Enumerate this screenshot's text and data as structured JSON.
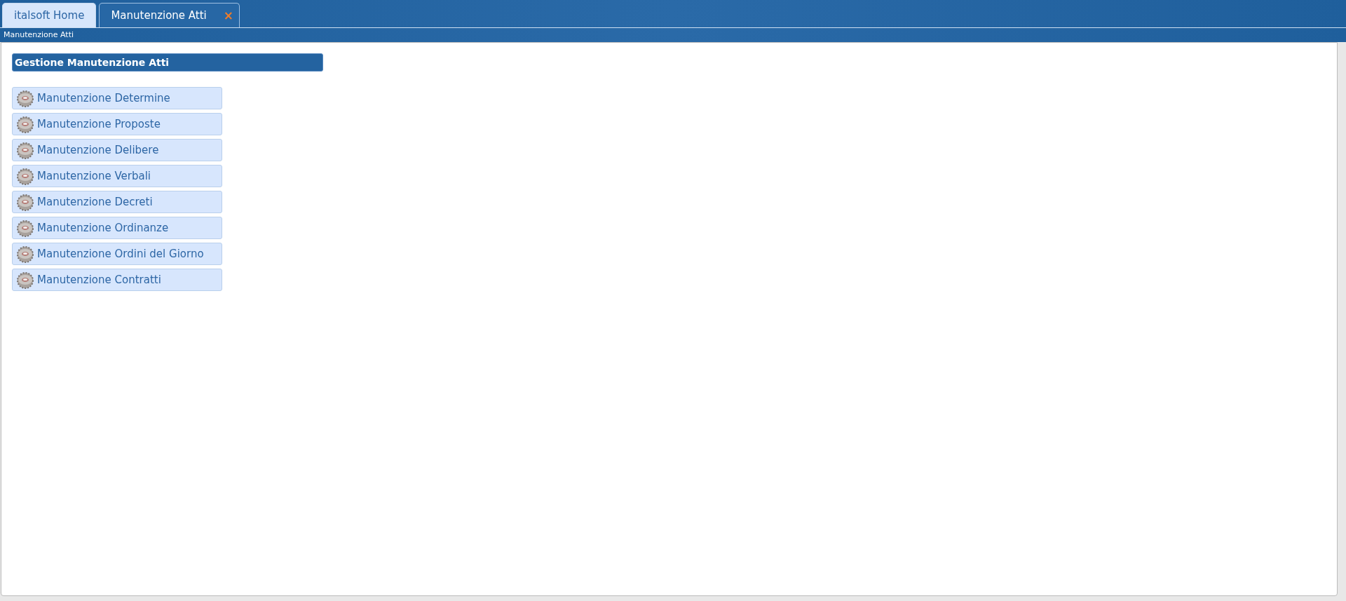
{
  "tabs": [
    {
      "label": "italsoft Home",
      "selected": false
    },
    {
      "label": "Manutenzione Atti",
      "selected": true,
      "close_glyph": "×"
    }
  ],
  "breadcrumb": "Manutenzione Atti",
  "panel": {
    "title": "Gestione Manutenzione Atti",
    "items": [
      {
        "label": "Manutenzione Determine"
      },
      {
        "label": "Manutenzione Proposte"
      },
      {
        "label": "Manutenzione Delibere"
      },
      {
        "label": "Manutenzione Verbali"
      },
      {
        "label": "Manutenzione Decreti"
      },
      {
        "label": "Manutenzione Ordinanze"
      },
      {
        "label": "Manutenzione Ordini del Giorno"
      },
      {
        "label": "Manutenzione Contratti"
      }
    ]
  }
}
